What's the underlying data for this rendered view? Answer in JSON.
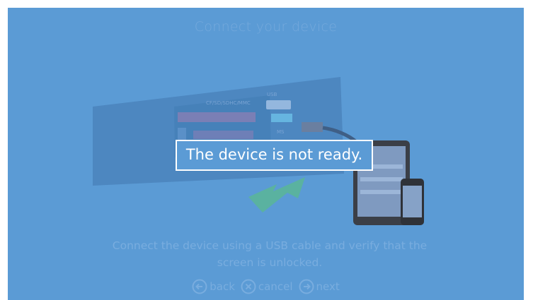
{
  "screen": {
    "title": "Connect your device",
    "port_labels": {
      "memory": "CF/SD/SDHC/MMC",
      "usb": "USB",
      "ms": "MS"
    },
    "message": "The device is not ready.",
    "instruction_line1": "Connect the device using a USB cable and verify that the",
    "instruction_line2": "screen is unlocked.",
    "nav": {
      "back": "back",
      "cancel": "cancel",
      "next": "next"
    }
  },
  "colors": {
    "background": "#5b9bd5",
    "message_border": "#ffffff",
    "faded_text": "#79addf"
  }
}
